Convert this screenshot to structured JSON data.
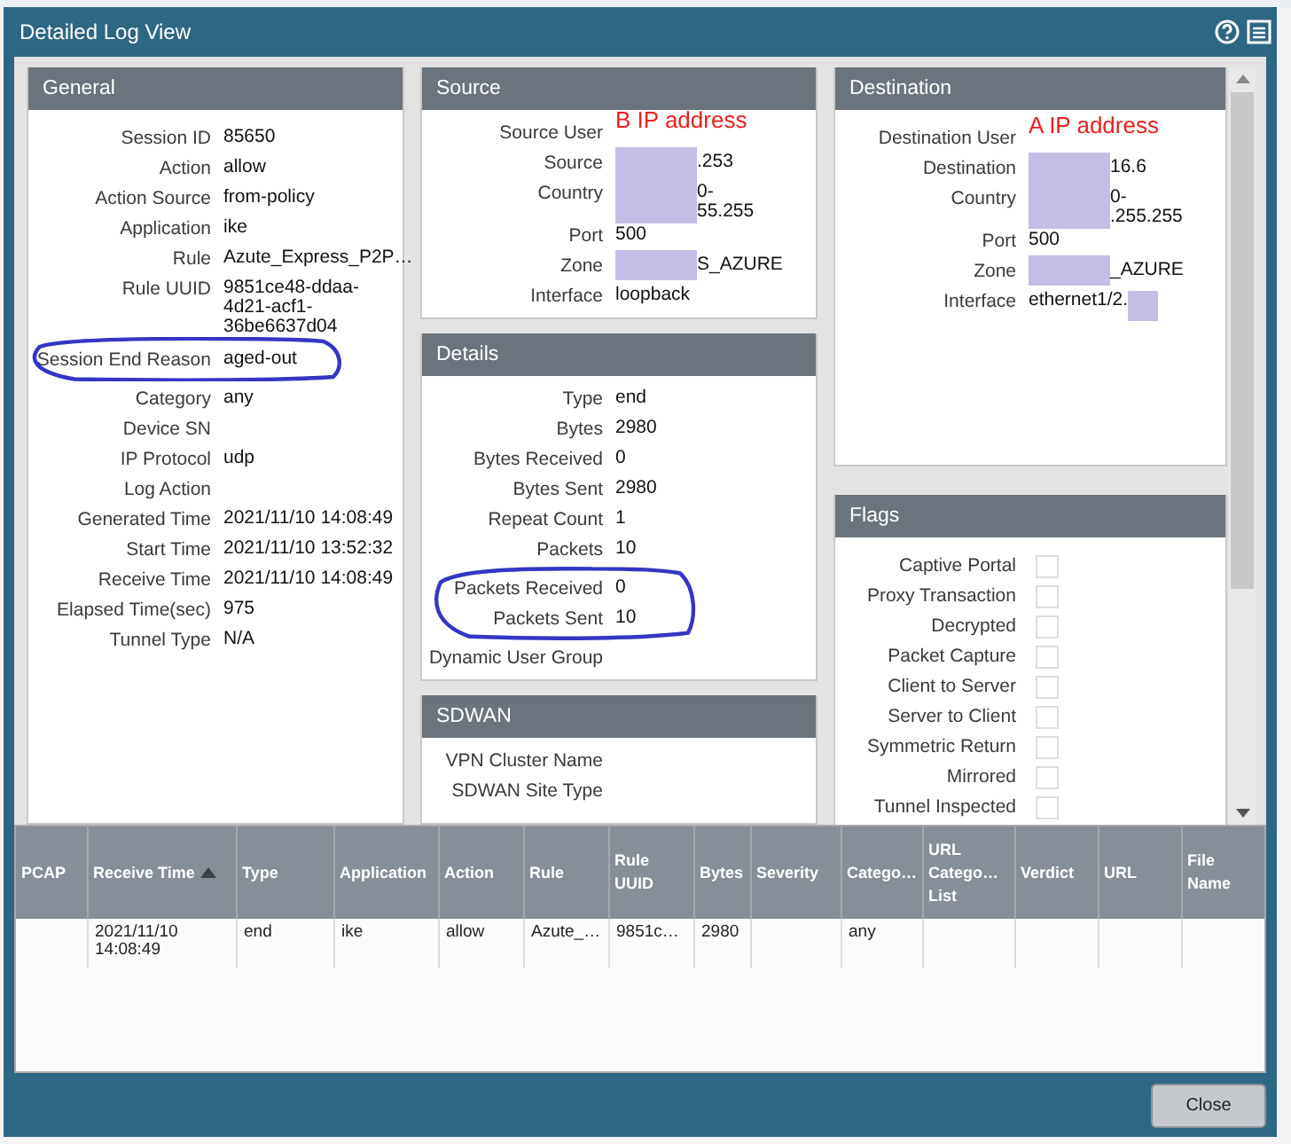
{
  "window": {
    "title": "Detailed Log View"
  },
  "panels": {
    "general": {
      "title": "General",
      "fields": [
        {
          "label": "Session ID",
          "value": "85650"
        },
        {
          "label": "Action",
          "value": "allow"
        },
        {
          "label": "Action Source",
          "value": "from-policy"
        },
        {
          "label": "Application",
          "value": "ike"
        },
        {
          "label": "Rule",
          "value": "Azute_Express_P2P…"
        },
        {
          "label": "Rule UUID",
          "value": "9851ce48-ddaa-4d21-acf1-36be6637d04"
        },
        {
          "label": "Session End Reason",
          "value": "aged-out"
        },
        {
          "label": "Category",
          "value": "any"
        },
        {
          "label": "Device SN"
        },
        {
          "label": "IP Protocol",
          "value": "udp"
        },
        {
          "label": "Log Action"
        },
        {
          "label": "Generated Time",
          "value": "2021/11/10 14:08:49"
        },
        {
          "label": "Start Time",
          "value": "2021/11/10 13:52:32"
        },
        {
          "label": "Receive Time",
          "value": "2021/11/10 14:08:49"
        },
        {
          "label": "Elapsed Time(sec)",
          "value": "975"
        },
        {
          "label": "Tunnel Type",
          "value": "N/A"
        }
      ]
    },
    "source": {
      "title": "Source",
      "fields": [
        {
          "label": "Source User",
          "note": "B IP address"
        },
        {
          "label": "Source",
          "value": ".253",
          "masked_before": true
        },
        {
          "label": "Country",
          "value": "0-\n55.255",
          "masked_before": true
        },
        {
          "label": "Port",
          "value": "500"
        },
        {
          "label": "Zone",
          "value": "S_AZURE",
          "masked_before": true
        },
        {
          "label": "Interface",
          "value": "loopback"
        }
      ]
    },
    "details": {
      "title": "Details",
      "fields": [
        {
          "label": "Type",
          "value": "end"
        },
        {
          "label": "Bytes",
          "value": "2980"
        },
        {
          "label": "Bytes Received",
          "value": "0"
        },
        {
          "label": "Bytes Sent",
          "value": "2980"
        },
        {
          "label": "Repeat Count",
          "value": "1"
        },
        {
          "label": "Packets",
          "value": "10"
        },
        {
          "label": "Packets Received",
          "value": "0"
        },
        {
          "label": "Packets Sent",
          "value": "10"
        },
        {
          "label": "Dynamic User Group"
        }
      ]
    },
    "sdwan": {
      "title": "SDWAN",
      "fields": [
        {
          "label": "VPN Cluster Name"
        },
        {
          "label": "SDWAN Site Type"
        }
      ]
    },
    "destination": {
      "title": "Destination",
      "fields": [
        {
          "label": "Destination User",
          "note": "A IP address"
        },
        {
          "label": "Destination",
          "value": "16.6",
          "masked_before": true
        },
        {
          "label": "Country",
          "value": "0-\n.255.255",
          "masked_before": true
        },
        {
          "label": "Port",
          "value": "500"
        },
        {
          "label": "Zone",
          "value": "_AZURE",
          "masked_before": true
        },
        {
          "label": "Interface",
          "value": "ethernet1/2.",
          "masked_after": true
        }
      ]
    },
    "flags": {
      "title": "Flags",
      "items": [
        {
          "label": "Captive Portal",
          "checked": false
        },
        {
          "label": "Proxy Transaction",
          "checked": false
        },
        {
          "label": "Decrypted",
          "checked": false
        },
        {
          "label": "Packet Capture",
          "checked": false
        },
        {
          "label": "Client to Server",
          "checked": false
        },
        {
          "label": "Server to Client",
          "checked": false
        },
        {
          "label": "Symmetric Return",
          "checked": false
        },
        {
          "label": "Mirrored",
          "checked": false
        },
        {
          "label": "Tunnel Inspected",
          "checked": false
        }
      ]
    }
  },
  "table": {
    "columns": [
      {
        "label": "PCAP",
        "sorted": false
      },
      {
        "label": "Receive Time",
        "sorted": true
      },
      {
        "label": "Type",
        "sorted": false
      },
      {
        "label": "Application",
        "sorted": false
      },
      {
        "label": "Action",
        "sorted": false
      },
      {
        "label": "Rule",
        "sorted": false
      },
      {
        "label": "Rule UUID",
        "sorted": false
      },
      {
        "label": "Bytes",
        "sorted": false
      },
      {
        "label": "Severity",
        "sorted": false
      },
      {
        "label": "Catego…",
        "sorted": false
      },
      {
        "label": "URL Catego… List",
        "sorted": false
      },
      {
        "label": "Verdict",
        "sorted": false
      },
      {
        "label": "URL",
        "sorted": false
      },
      {
        "label": "File Name",
        "sorted": false
      }
    ],
    "rows": [
      [
        "",
        "2021/11/10 14:08:49",
        "end",
        "ike",
        "allow",
        "Azute_…",
        "9851c…",
        "2980",
        "",
        "any",
        "",
        "",
        "",
        ""
      ]
    ]
  },
  "buttons": [
    "Close"
  ]
}
